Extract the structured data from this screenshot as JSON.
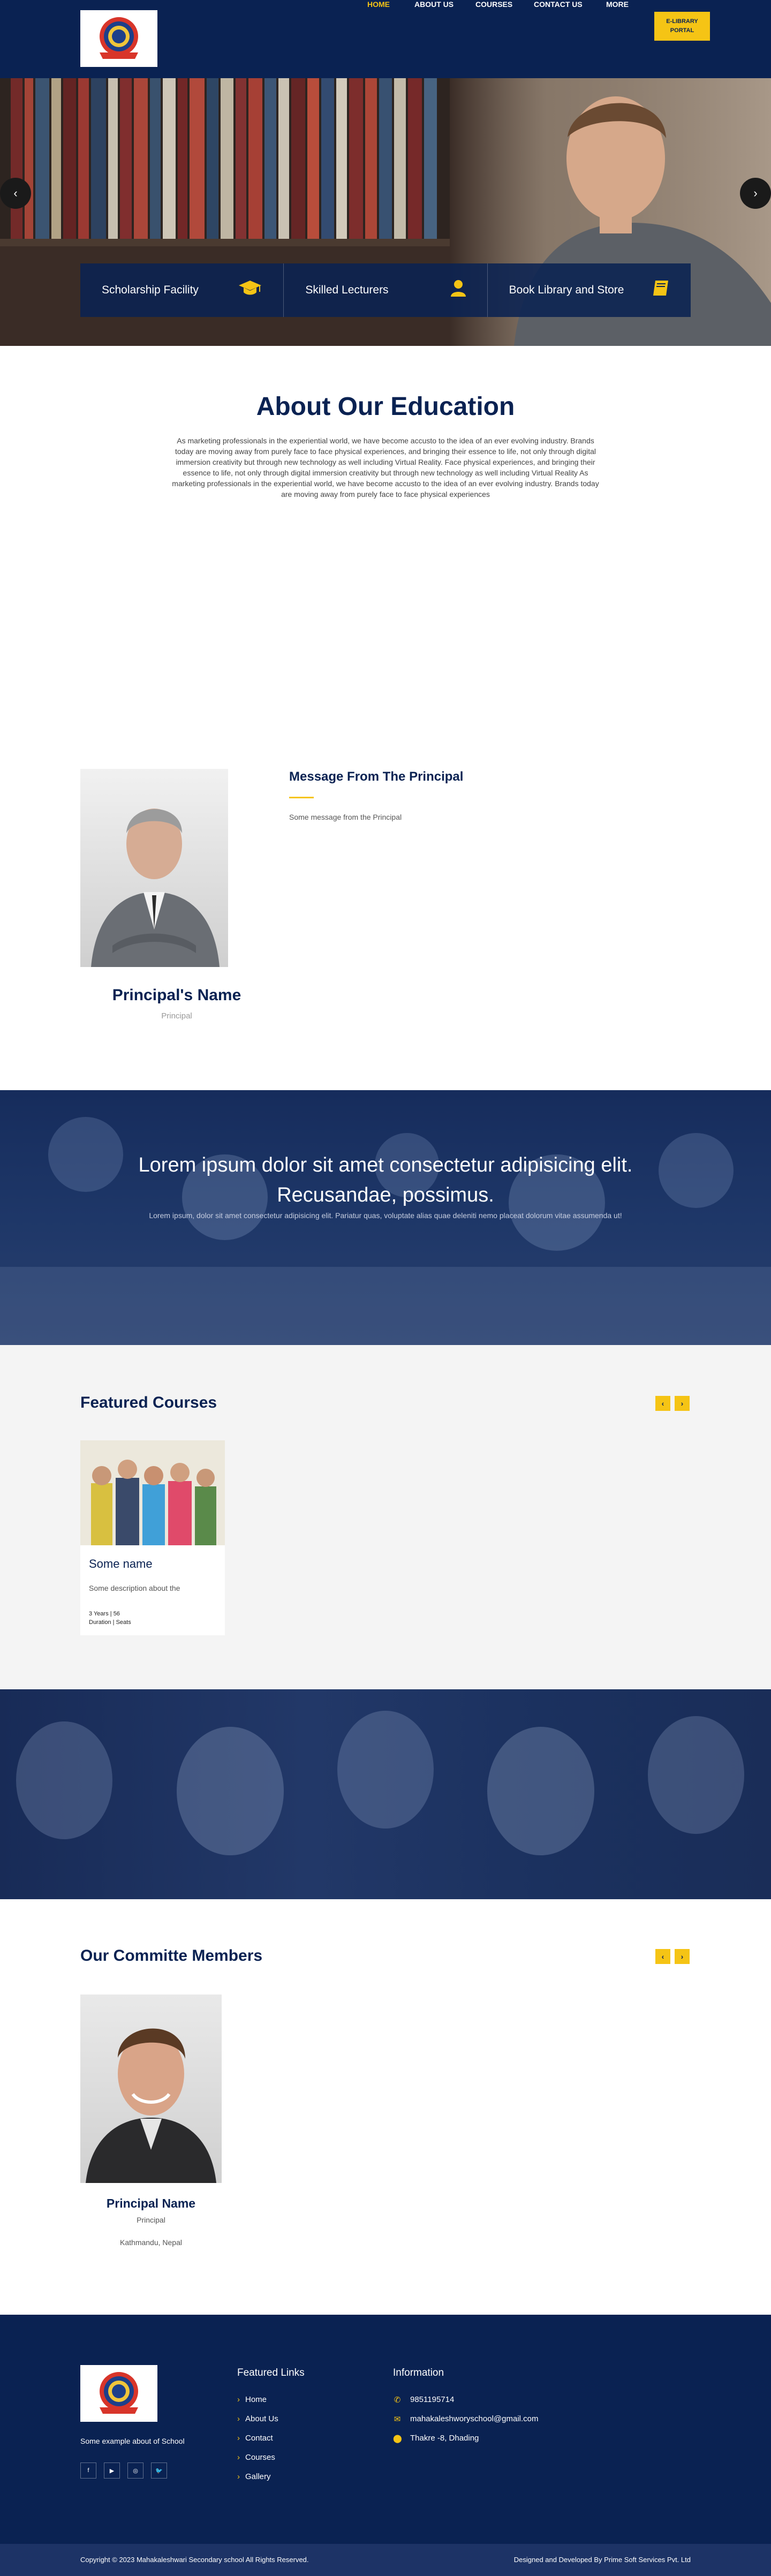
{
  "header": {
    "nav": [
      "HOME",
      "ABOUT US",
      "COURSES",
      "CONTACT US",
      "MORE"
    ],
    "eportal": [
      "E-LIBRARY",
      "PORTAL"
    ]
  },
  "hero": {
    "prev": "‹",
    "next": "›",
    "features": [
      {
        "label": "Scholarship Facility",
        "icon": "graduation-cap-icon"
      },
      {
        "label": "Skilled Lecturers",
        "icon": "user-icon"
      },
      {
        "label": "Book Library and Store",
        "icon": "book-icon"
      }
    ]
  },
  "about": {
    "title": "About Our Education",
    "text": "As marketing professionals in the experiential world, we have become accusto to the idea of an ever evolving industry. Brands today are moving away from purely face to face physical experiences, and bringing their essence to life, not only through digital immersion creativity but through new technology as well including Virtual Reality. Face physical experiences, and bringing their essence to life, not only through digital immersion creativity but through new technology as well including Virtual Reality As marketing professionals in the experiential world, we have become accusto to the idea of an ever evolving industry. Brands today are moving away from purely face to face physical experiences"
  },
  "principal": {
    "msg_title": "Message From The Principal",
    "msg_text": "Some message from the Principal",
    "name": "Principal's Name",
    "role": "Principal"
  },
  "quote": {
    "title": "Lorem ipsum dolor sit amet consectetur adipisicing elit. Recusandae, possimus.",
    "sub": "Lorem ipsum, dolor sit amet consectetur adipisicing elit. Pariatur quas, voluptate alias quae deleniti nemo placeat dolorum vitae assumenda ut!"
  },
  "courses": {
    "title": "Featured Courses",
    "prev": "‹",
    "next": "›",
    "card": {
      "name": "Some name",
      "desc": "Some description about the",
      "duration_value": "3 Years",
      "duration_label": "Duration",
      "seats_value": "56",
      "seats_label": "Seats"
    }
  },
  "committee": {
    "title": "Our Committe Members",
    "prev": "‹",
    "next": "›",
    "member": {
      "name": "Principal Name",
      "role": "Principal",
      "place": "Kathmandu, Nepal"
    }
  },
  "footer": {
    "about": "Some example about of School",
    "socials": [
      "f",
      "▶",
      "◎",
      "🐦"
    ],
    "links_title": "Featured Links",
    "links": [
      "Home",
      "About Us",
      "Contact",
      "Courses",
      "Gallery"
    ],
    "info_title": "Information",
    "info": [
      {
        "icon": "phone-icon",
        "glyph": "✆",
        "text": "9851195714"
      },
      {
        "icon": "mail-icon",
        "glyph": "✉",
        "text": "mahakaleshworyschool@gmail.com"
      },
      {
        "icon": "location-icon",
        "glyph": "⬤",
        "text": "Thakre -8, Dhading"
      }
    ],
    "copyright": "Copyright © 2023 Mahakaleshwari Secondary school All Rights Reserved.",
    "designed": "Designed and Developed By Prime Soft Services Pvt. Ltd"
  },
  "colors": {
    "navy": "#0a2252",
    "accent": "#f5c415"
  }
}
